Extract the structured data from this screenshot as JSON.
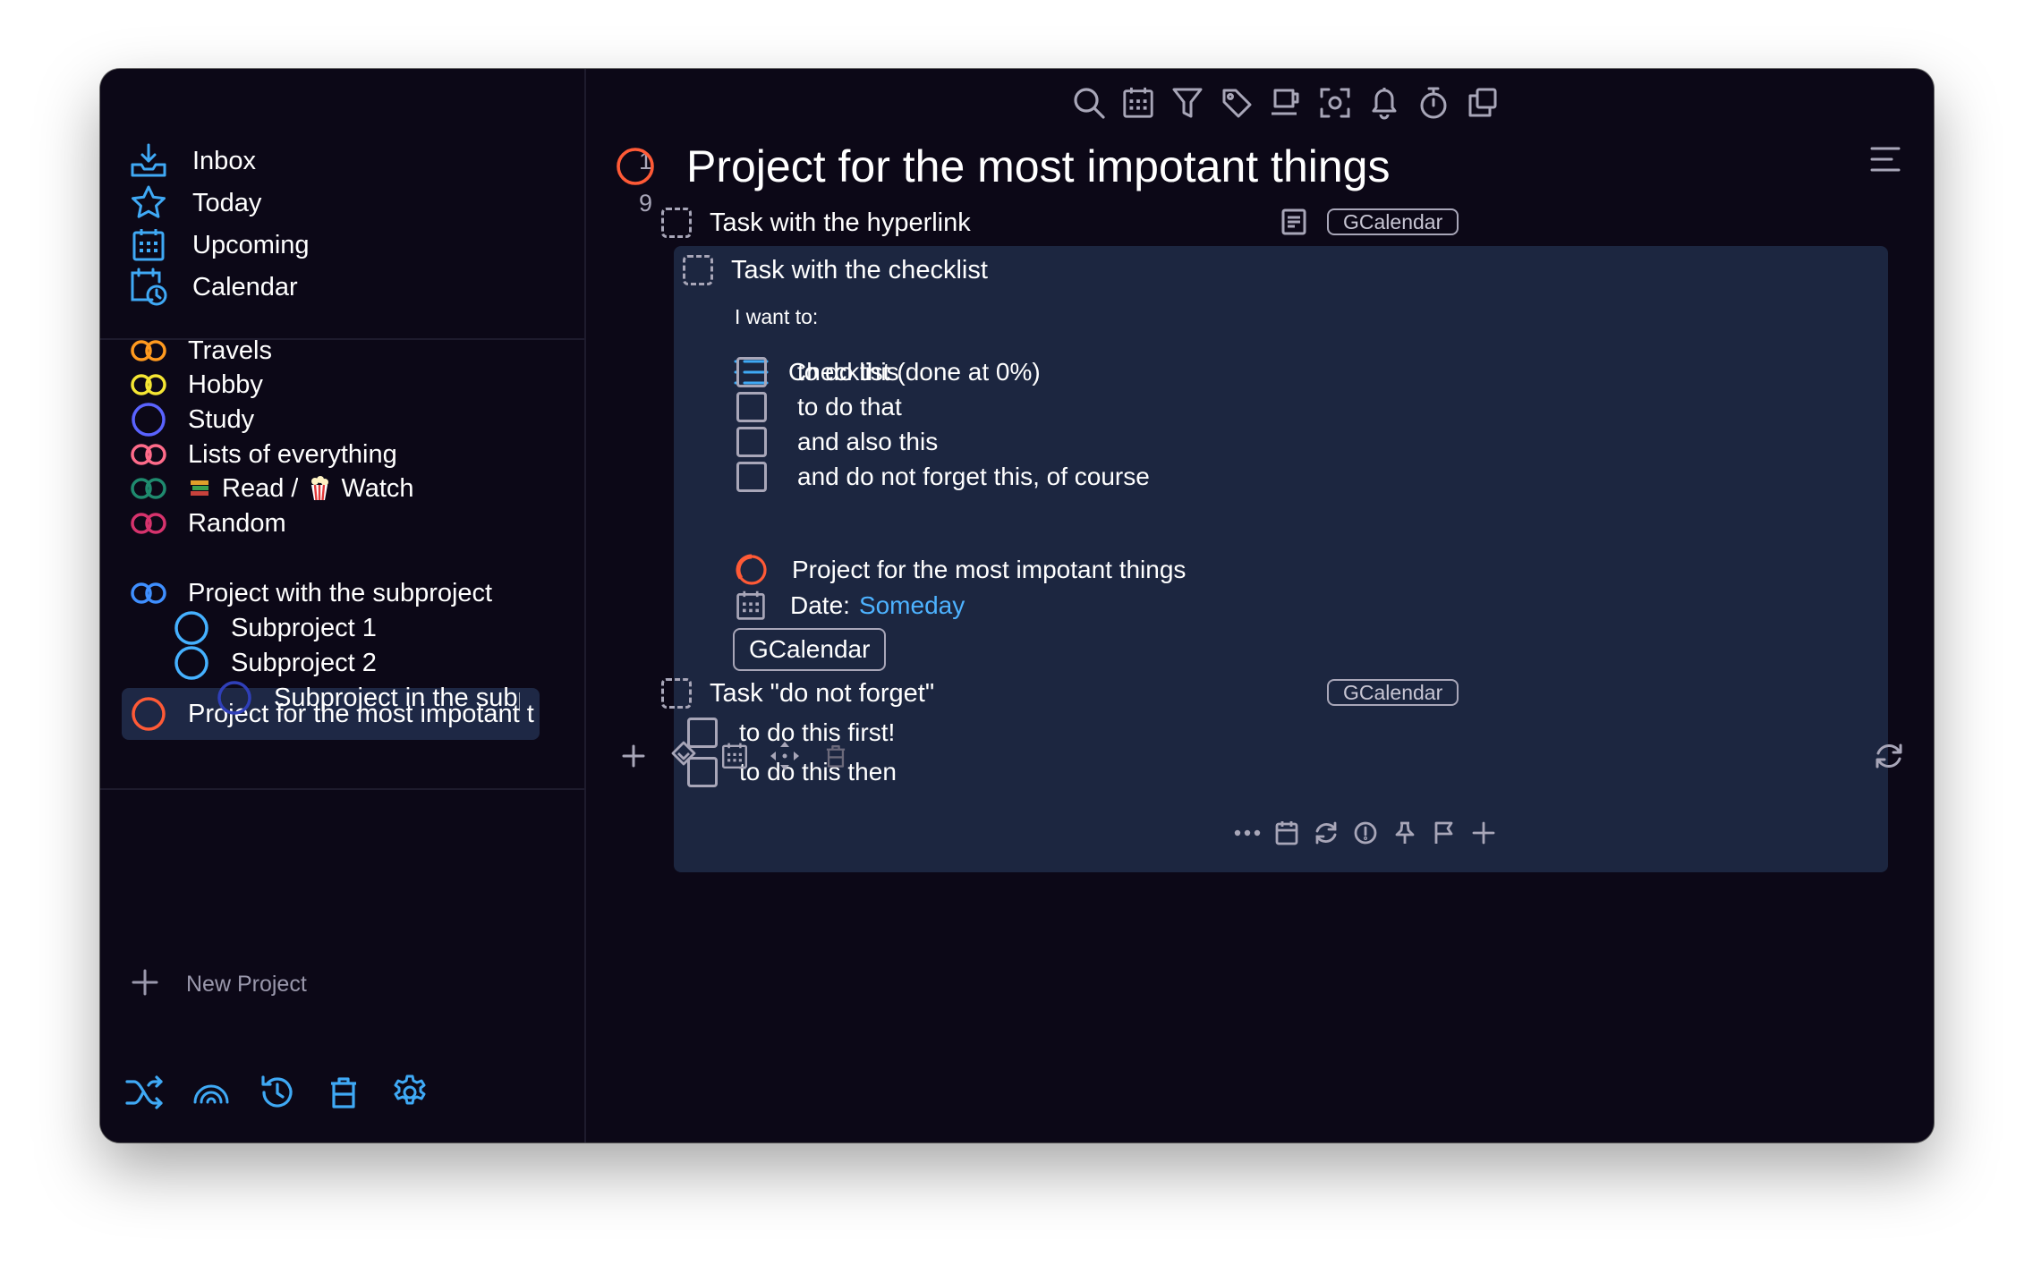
{
  "sidebar": {
    "nav": [
      {
        "label": "Inbox",
        "count": "1",
        "icon": "inbox-icon"
      },
      {
        "label": "Today",
        "count": "9",
        "icon": "star-icon"
      },
      {
        "label": "Upcoming",
        "count": "",
        "icon": "calendar-grid-icon"
      },
      {
        "label": "Calendar",
        "count": "",
        "icon": "calendar-clock-icon"
      }
    ],
    "projects": [
      {
        "label": "Travels",
        "color": "#ff9a1f"
      },
      {
        "label": "Hobby",
        "color": "#f5e633"
      },
      {
        "label": "Study",
        "color": "#5a63ff"
      },
      {
        "label": "Lists of everything",
        "color": "#ff6b8a"
      },
      {
        "label": "Read /",
        "label2": "Watch",
        "color": "#1f8a6e"
      },
      {
        "label": "Random",
        "color": "#d7336d"
      },
      {
        "label": "Project for the most impotant things",
        "color": "#ff5a36"
      },
      {
        "label": "Project with the subproject",
        "color": "#3f8fff"
      },
      {
        "label": "Subproject 1",
        "color": "#45b1ff"
      },
      {
        "label": "Subproject 2",
        "color": "#45b1ff"
      },
      {
        "label": "Subproject in the subproject",
        "color": "#2f3fb8"
      }
    ],
    "new_project_label": "New Project"
  },
  "main": {
    "title": "Project for the most impotant things",
    "tasks": [
      {
        "title": "Task with the hyperlink",
        "chip": "GCalendar"
      },
      {
        "title": "Task with the checklist"
      },
      {
        "title": "Task \"do not forget\"",
        "chip": "GCalendar"
      }
    ],
    "expanded": {
      "note": "I want to:",
      "checklist_header": "Checklist (done at 0%)",
      "items": [
        "to do this",
        "to do that",
        "and also this",
        "and do not forget this, of course"
      ],
      "chip": "GCalendar",
      "project": "Project for the most impotant things",
      "date_label": "Date:",
      "date_value": "Someday"
    },
    "dnf_items": [
      "to do this first!",
      "to do this then"
    ]
  },
  "colors": {
    "accent": "#3fa9f5",
    "window_bg": "#0c0817",
    "expanded_bg": "#1c2640",
    "active_project_bg": "#1e2845",
    "project_ring": "#ff5a36"
  }
}
